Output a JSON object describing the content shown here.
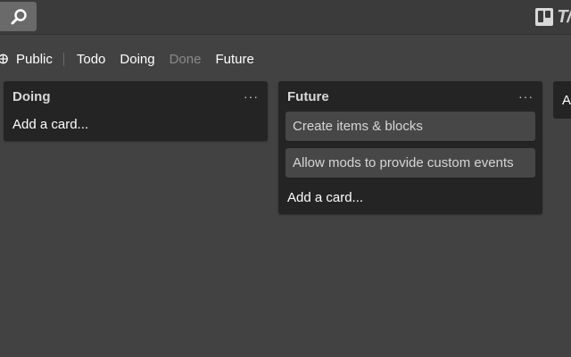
{
  "header": {
    "search_icon": "magnifier-icon",
    "brand_icon": "board-icon",
    "brand_text": "T/"
  },
  "filters": {
    "visibility_icon": "globe-icon",
    "visibility_label": "Public",
    "items": [
      "Todo",
      "Doing",
      "Done",
      "Future"
    ]
  },
  "lists": [
    {
      "title": "Doing",
      "menu": "···",
      "cards": [],
      "add_card": "Add a card..."
    },
    {
      "title": "Future",
      "menu": "···",
      "cards": [
        "Create items & blocks",
        "Allow mods to provide custom events"
      ],
      "add_card": "Add a card..."
    }
  ],
  "add_list": {
    "label": "A"
  },
  "colors": {
    "background": "#424242",
    "topbar": "#3b3b3b",
    "list": "#242424",
    "card": "#474747",
    "muted_text": "#8a8a8a"
  }
}
